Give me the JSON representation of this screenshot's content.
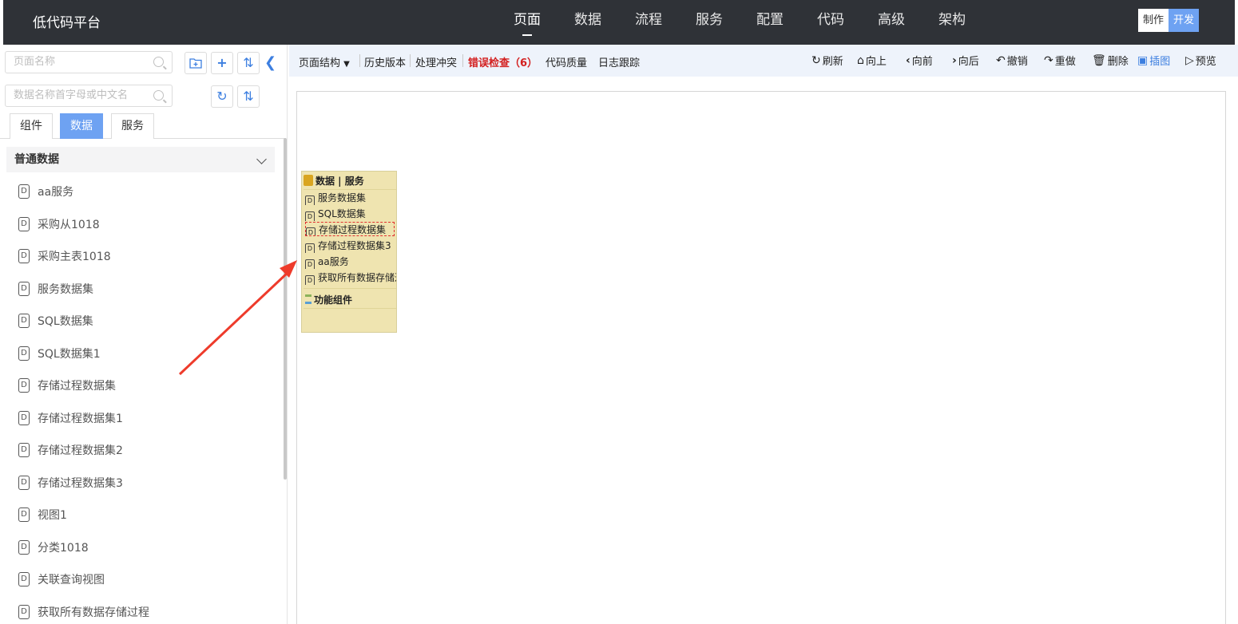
{
  "app": {
    "title": "低代码平台"
  },
  "nav": [
    "页面",
    "数据",
    "流程",
    "服务",
    "配置",
    "代码",
    "高级",
    "架构"
  ],
  "nav_active": "页面",
  "mode": {
    "make": "制作",
    "dev": "开发"
  },
  "left": {
    "search_page_placeholder": "页面名称",
    "search_data_placeholder": "数据名称首字母或中文名",
    "tabs": [
      "组件",
      "数据",
      "服务"
    ],
    "active_tab": "数据",
    "section_title": "普通数据",
    "items": [
      "aa服务",
      "采购从1018",
      "采购主表1018",
      "服务数据集",
      "SQL数据集",
      "SQL数据集1",
      "存储过程数据集",
      "存储过程数据集1",
      "存储过程数据集2",
      "存储过程数据集3",
      "视图1",
      "分类1018",
      "关联查询视图",
      "获取所有数据存储过程"
    ]
  },
  "toolbar": {
    "left": [
      "页面结构",
      "历史版本",
      "处理冲突",
      "错误检查（6）",
      "代码质量",
      "日志跟踪"
    ],
    "right": [
      "刷新",
      "向上",
      "向前",
      "向后",
      "撤销",
      "重做",
      "删除",
      "插图",
      "预览"
    ]
  },
  "widget": {
    "header": "数据 | 服务",
    "rows": [
      "服务数据集",
      "SQL数据集",
      "存储过程数据集",
      "存储过程数据集3",
      "aa服务",
      "获取所有数据存储过程"
    ],
    "selected_row": "存储过程数据集",
    "func": "功能组件",
    "doc_glyph": "D"
  },
  "colors": {
    "topbar": "#2f3237",
    "accent": "#6ea2f2",
    "error": "#d32020",
    "widget_bg": "#efe4b0",
    "arrow": "#ee3b2b"
  }
}
